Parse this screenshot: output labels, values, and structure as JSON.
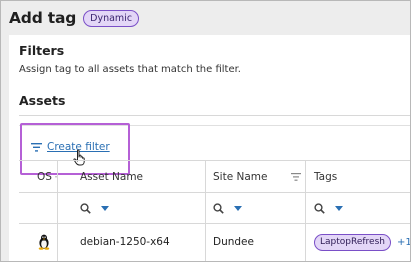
{
  "header": {
    "title": "Add tag",
    "badge": "Dynamic"
  },
  "filters": {
    "title": "Filters",
    "description": "Assign tag to all assets that match the filter."
  },
  "assets": {
    "title": "Assets",
    "create_filter_label": "Create filter",
    "columns": [
      {
        "label": "OS"
      },
      {
        "label": "Asset Name"
      },
      {
        "label": "Site Name"
      },
      {
        "label": "Tags"
      }
    ],
    "rows": [
      {
        "os_icon": "linux-icon",
        "asset_name": "debian-1250-x64",
        "site_name": "Dundee",
        "tag": "LaptopRefresh",
        "more_tags": "+1"
      }
    ]
  },
  "colors": {
    "accent_purple": "#b560d6",
    "link_blue": "#2a6fb3",
    "badge_bg": "#e3d6f7"
  }
}
